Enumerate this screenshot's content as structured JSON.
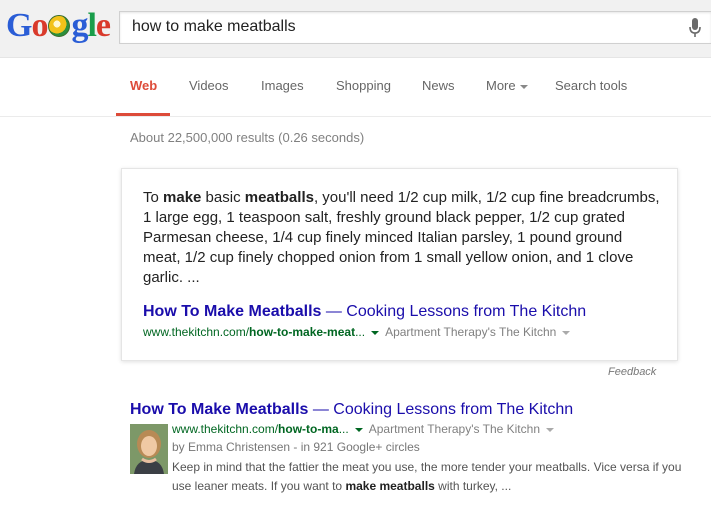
{
  "logo": {
    "letters": [
      "G",
      "o",
      "g",
      "l",
      "e"
    ]
  },
  "search": {
    "query": "how to make meatballs"
  },
  "nav": {
    "items": [
      "Web",
      "Videos",
      "Images",
      "Shopping",
      "News",
      "More",
      "Search tools"
    ],
    "active": "Web"
  },
  "stats": "About 22,500,000 results (0.26 seconds)",
  "answer": {
    "t1": "To ",
    "b1": "make",
    "t2": " basic ",
    "b2": "meatballs",
    "t3": ", you'll need 1/2 cup milk, 1/2 cup fine breadcrumbs, 1 large egg, 1 teaspoon salt, freshly ground black pepper, 1/2 cup grated Parmesan cheese, 1/4 cup finely minced Italian parsley, 1 pound ground meat, 1/2 cup finely chopped onion from 1 small yellow onion, and 1 clove garlic. ...",
    "link_bold": "How To Make Meatballs",
    "link_rest": " — Cooking Lessons from The Kitchn",
    "url_plain": "www.thekitchn.com/",
    "url_bold": "how-to-make-meat",
    "url_tail": "...",
    "source": "Apartment Therapy's The Kitchn",
    "feedback": "Feedback"
  },
  "result": {
    "title_bold": "How To Make Meatballs",
    "title_rest": " — Cooking Lessons from The Kitchn",
    "url_plain": "www.thekitchn.com/",
    "url_bold": "how-to-ma",
    "url_tail": "...",
    "source": "Apartment Therapy's The Kitchn",
    "author": "by Emma Christensen - in 921 Google+ circles",
    "s1": "Keep in mind that the fattier the meat you use, the more tender your meatballs. Vice versa if you use leaner meats. If you want to ",
    "sb1": "make meatballs",
    "s2": " with turkey, ..."
  },
  "colors": {
    "accent": "#dd4b39",
    "link": "#1a0dab",
    "url": "#006621"
  }
}
